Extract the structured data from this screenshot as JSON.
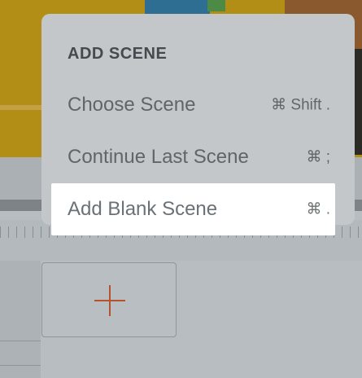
{
  "menu": {
    "title": "ADD SCENE",
    "items": [
      {
        "label": "Choose Scene",
        "shortcut": "⌘ Shift ."
      },
      {
        "label": "Continue Last Scene",
        "shortcut": "⌘ ;"
      },
      {
        "label": "Add Blank Scene",
        "shortcut": "⌘ .",
        "highlighted": true
      }
    ]
  },
  "timeline": {
    "add_tile_icon": "plus-icon"
  },
  "colors": {
    "menu_bg": "#c3c7c9",
    "highlight_bg": "#ffffff",
    "plus_accent": "#b5532f",
    "scene_bg": "#b38e17"
  }
}
